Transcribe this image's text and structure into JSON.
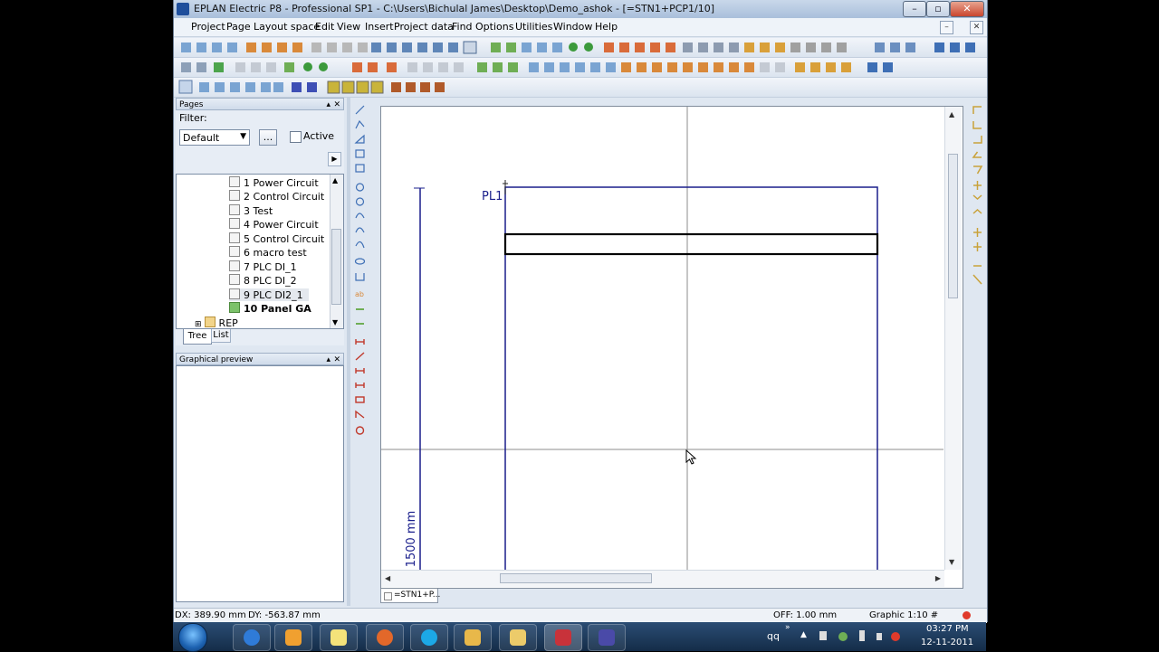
{
  "window": {
    "title": "EPLAN Electric P8 - Professional SP1 - C:\\Users\\Bichulal James\\Desktop\\Demo_ashok - [=STN1+PCP1/10]",
    "minimize": "–",
    "maximize": "▫",
    "close": "✕"
  },
  "menu": {
    "items": [
      "Project",
      "Page",
      "Layout space",
      "Edit",
      "View",
      "Insert",
      "Project data",
      "Find",
      "Options",
      "Utilities",
      "Window",
      "Help"
    ],
    "mdi_minimize": "–",
    "mdi_close": "✕"
  },
  "pages_panel": {
    "title": "Pages",
    "filter_label": "Filter:",
    "filter_value": "Default",
    "browse_button": "...",
    "active_label": "Active",
    "tree": [
      "1 Power Circuit",
      "2 Control Circuit",
      "3 Test",
      "4 Power Circuit",
      "5 Control Circuit",
      "6  macro test",
      "7 PLC DI_1",
      "8 PLC DI_2",
      "9 PLC DI2_1",
      "10 Panel GA"
    ],
    "rep_node": "REP",
    "tabs": [
      "Tree",
      "List"
    ]
  },
  "preview_panel": {
    "title": "Graphical preview"
  },
  "canvas": {
    "label_pl1": "PL1",
    "dimension_label": "1500 mm",
    "tab_label": "=STN1+P..."
  },
  "status": {
    "dx": "DX: 389.90 mm",
    "dy": "DY: -563.87 mm",
    "off": "OFF: 1.00 mm",
    "graphic": "Graphic 1:10 #"
  },
  "taskbar": {
    "tray_label": "qq",
    "time": "03:27 PM",
    "date": "12-11-2011"
  },
  "colors": {
    "drawing_blue": "#1a1f8c",
    "status_red": "#e03a2b"
  }
}
